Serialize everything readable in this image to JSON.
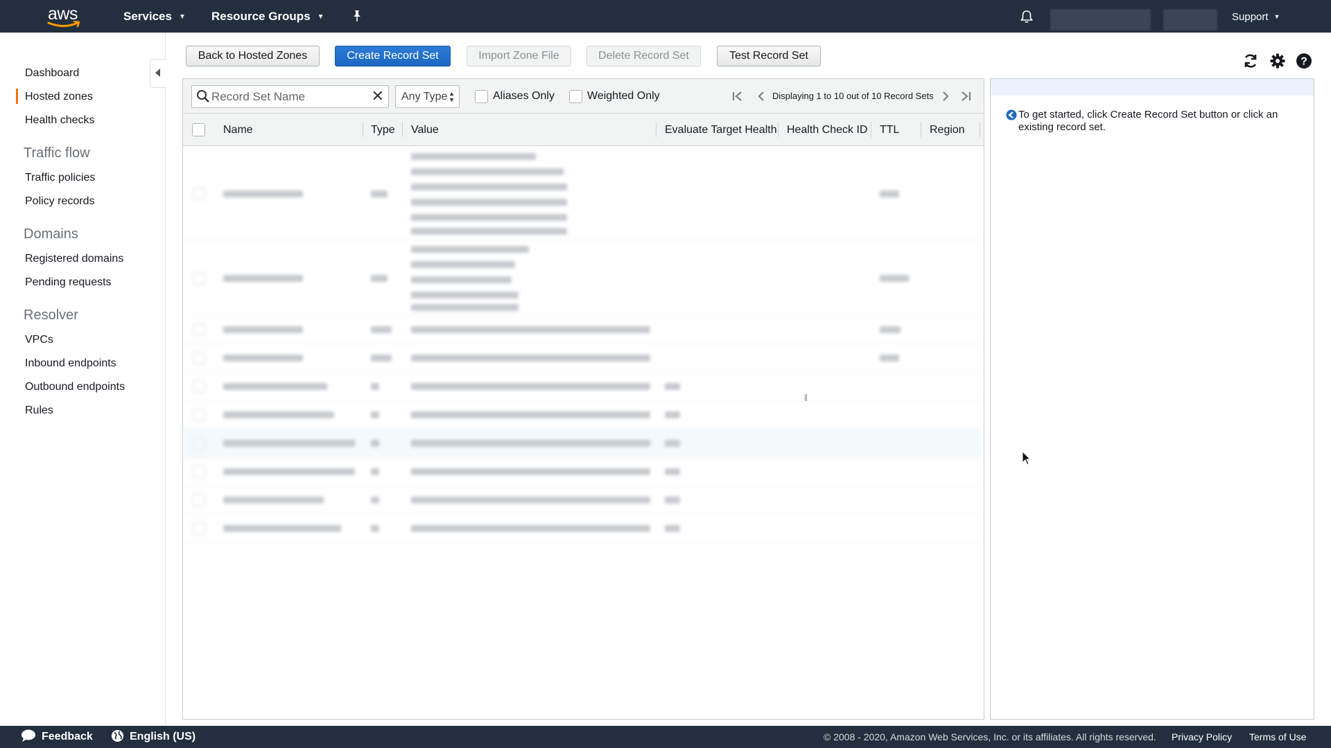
{
  "topnav": {
    "logo_text": "aws",
    "services_label": "Services",
    "resource_groups_label": "Resource Groups",
    "support_label": "Support"
  },
  "sidebar": {
    "links_top": [
      "Dashboard",
      "Hosted zones",
      "Health checks"
    ],
    "traffic_flow": {
      "heading": "Traffic flow",
      "items": [
        "Traffic policies",
        "Policy records"
      ]
    },
    "domains": {
      "heading": "Domains",
      "items": [
        "Registered domains",
        "Pending requests"
      ]
    },
    "resolver": {
      "heading": "Resolver",
      "items": [
        "VPCs",
        "Inbound endpoints",
        "Outbound endpoints",
        "Rules"
      ]
    },
    "active_item": "Hosted zones"
  },
  "toolbar": {
    "back_label": "Back to Hosted Zones",
    "create_label": "Create Record Set",
    "import_label": "Import Zone File",
    "delete_label": "Delete Record Set",
    "test_label": "Test Record Set"
  },
  "filters": {
    "search_placeholder": "Record Set Name",
    "type_select": "Any Type",
    "aliases_only": "Aliases Only",
    "weighted_only": "Weighted Only",
    "pager_text": "Displaying 1 to 10 out of 10 Record Sets"
  },
  "table": {
    "columns": [
      "Name",
      "Type",
      "Value",
      "Evaluate Target Health",
      "Health Check ID",
      "TTL",
      "Region"
    ],
    "row_count": 10,
    "highlighted_row": 7
  },
  "info_panel": {
    "message": "To get started, click Create Record Set button or click an existing record set."
  },
  "footer": {
    "feedback": "Feedback",
    "language": "English (US)",
    "copyright": "© 2008 - 2020, Amazon Web Services, Inc. or its affiliates. All rights reserved.",
    "privacy": "Privacy Policy",
    "terms": "Terms of Use"
  },
  "colors": {
    "nav_bg": "#232f3e",
    "accent_orange": "#ec7211",
    "primary_blue": "#1a67c1",
    "info_blue": "#eaf3fb"
  }
}
